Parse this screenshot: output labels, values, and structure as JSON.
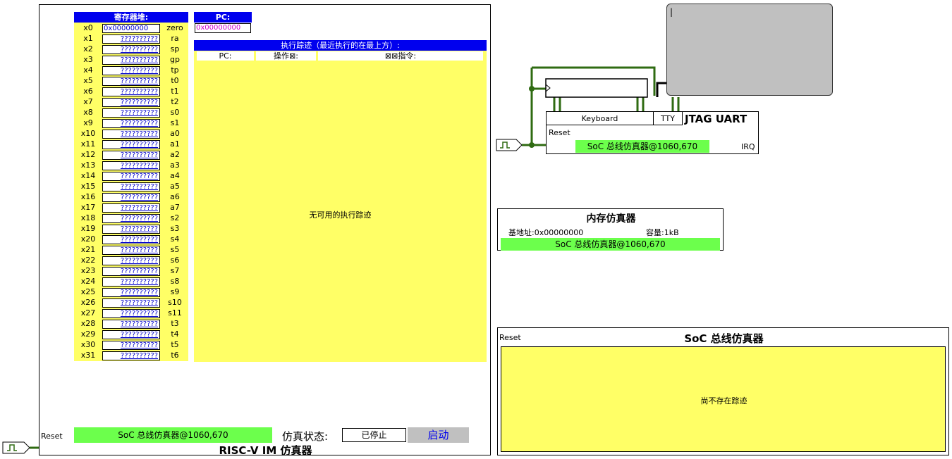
{
  "cpu": {
    "title": "RISC-V IM 仿真器",
    "reset_label": "Reset",
    "bus_label": "SoC 总线仿真器@1060,670",
    "status_label": "仿真状态:",
    "status_value": "已停止",
    "start_button": "启动",
    "regfile_title": "寄存器堆:",
    "pc_title": "PC:",
    "pc_value": "0x00000000",
    "registers": [
      {
        "name": "x0",
        "value": "0x00000000",
        "abi": "zero"
      },
      {
        "name": "x1",
        "value": "??????????",
        "abi": "ra"
      },
      {
        "name": "x2",
        "value": "??????????",
        "abi": "sp"
      },
      {
        "name": "x3",
        "value": "??????????",
        "abi": "gp"
      },
      {
        "name": "x4",
        "value": "??????????",
        "abi": "tp"
      },
      {
        "name": "x5",
        "value": "??????????",
        "abi": "t0"
      },
      {
        "name": "x6",
        "value": "??????????",
        "abi": "t1"
      },
      {
        "name": "x7",
        "value": "??????????",
        "abi": "t2"
      },
      {
        "name": "x8",
        "value": "??????????",
        "abi": "s0"
      },
      {
        "name": "x9",
        "value": "??????????",
        "abi": "s1"
      },
      {
        "name": "x10",
        "value": "??????????",
        "abi": "a0"
      },
      {
        "name": "x11",
        "value": "??????????",
        "abi": "a1"
      },
      {
        "name": "x12",
        "value": "??????????",
        "abi": "a2"
      },
      {
        "name": "x13",
        "value": "??????????",
        "abi": "a3"
      },
      {
        "name": "x14",
        "value": "??????????",
        "abi": "a4"
      },
      {
        "name": "x15",
        "value": "??????????",
        "abi": "a5"
      },
      {
        "name": "x16",
        "value": "??????????",
        "abi": "a6"
      },
      {
        "name": "x17",
        "value": "??????????",
        "abi": "a7"
      },
      {
        "name": "x18",
        "value": "??????????",
        "abi": "s2"
      },
      {
        "name": "x19",
        "value": "??????????",
        "abi": "s3"
      },
      {
        "name": "x20",
        "value": "??????????",
        "abi": "s4"
      },
      {
        "name": "x21",
        "value": "??????????",
        "abi": "s5"
      },
      {
        "name": "x22",
        "value": "??????????",
        "abi": "s6"
      },
      {
        "name": "x23",
        "value": "??????????",
        "abi": "s7"
      },
      {
        "name": "x24",
        "value": "??????????",
        "abi": "s8"
      },
      {
        "name": "x25",
        "value": "??????????",
        "abi": "s9"
      },
      {
        "name": "x26",
        "value": "??????????",
        "abi": "s10"
      },
      {
        "name": "x27",
        "value": "??????????",
        "abi": "s11"
      },
      {
        "name": "x28",
        "value": "??????????",
        "abi": "t3"
      },
      {
        "name": "x29",
        "value": "??????????",
        "abi": "t4"
      },
      {
        "name": "x30",
        "value": "??????????",
        "abi": "t5"
      },
      {
        "name": "x31",
        "value": "??????????",
        "abi": "t6"
      }
    ],
    "trace": {
      "title": "执行踪迹（最近执行的在最上方）:",
      "col_pc": "PC:",
      "col_op": "操作⊠:",
      "col_instr": "⊠⊠指令:",
      "empty_text": "无可用的执行踪迹"
    }
  },
  "jtag_uart": {
    "title": "JTAG UART",
    "keyboard_label": "Keyboard",
    "tty_label": "TTY",
    "reset_label": "Reset",
    "irq_label": "IRQ",
    "bus_label": "SoC 总线仿真器@1060,670",
    "tty_cursor": "|"
  },
  "memory": {
    "title": "内存仿真器",
    "base_label": "基地址:0x00000000",
    "size_label": "容量:1kB",
    "bus_label": "SoC 总线仿真器@1060,670"
  },
  "bus": {
    "title": "SoC 总线仿真器",
    "reset_label": "Reset",
    "empty_text": "尚不存在踪迹"
  },
  "colors": {
    "wire": "#2f6b12",
    "header_blue": "#0000ee",
    "yellow": "#ffff66",
    "green": "#6cff4c",
    "tty_gray": "#c0c0c0",
    "pc_magenta": "#cc00cc",
    "start_blue": "#0000ee"
  }
}
